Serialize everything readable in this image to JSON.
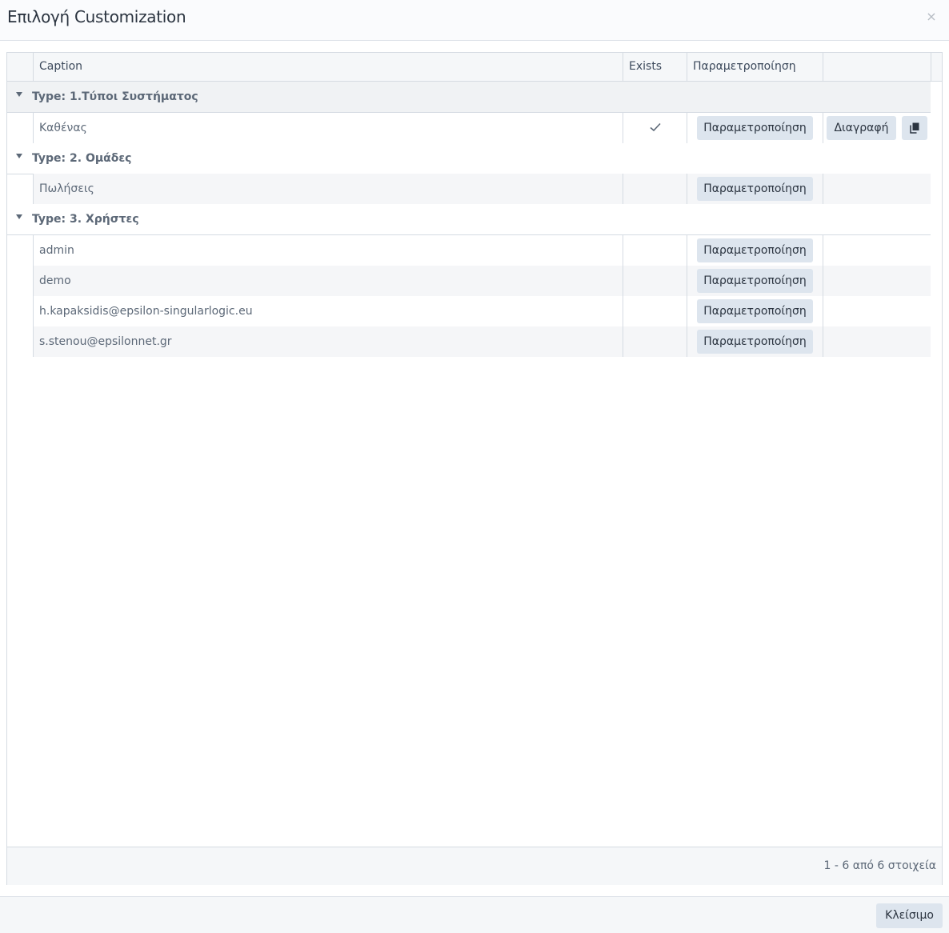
{
  "dialog": {
    "title": "Επιλογή Customization",
    "close_icon": "close-icon",
    "close_glyph": "×",
    "close_button_label": "Κλείσιμο"
  },
  "grid": {
    "columns": {
      "caption": "Caption",
      "exists": "Exists",
      "param": "Παραμετροποίηση",
      "actions": ""
    },
    "groups": [
      {
        "label": "Type: 1.Τύποι Συστήματος",
        "rows": [
          {
            "caption": "Καθένας",
            "exists": true,
            "param_label": "Παραμετροποίηση",
            "delete_label": "Διαγραφή",
            "copy_icon": "copy-icon"
          }
        ]
      },
      {
        "label": "Type: 2. Ομάδες",
        "rows": [
          {
            "caption": "Πωλήσεις",
            "exists": false,
            "param_label": "Παραμετροποίηση"
          }
        ]
      },
      {
        "label": "Type: 3. Χρήστες",
        "rows": [
          {
            "caption": "admin",
            "exists": false,
            "param_label": "Παραμετροποίηση"
          },
          {
            "caption": "demo",
            "exists": false,
            "param_label": "Παραμετροποίηση"
          },
          {
            "caption": "h.kapaksidis@epsilon-singularlogic.eu",
            "exists": false,
            "param_label": "Παραμετροποίηση"
          },
          {
            "caption": "s.stenou@epsilonnet.gr",
            "exists": false,
            "param_label": "Παραμετροποίηση"
          }
        ]
      }
    ],
    "pager": "1 - 6 από 6 στοιχεία"
  }
}
